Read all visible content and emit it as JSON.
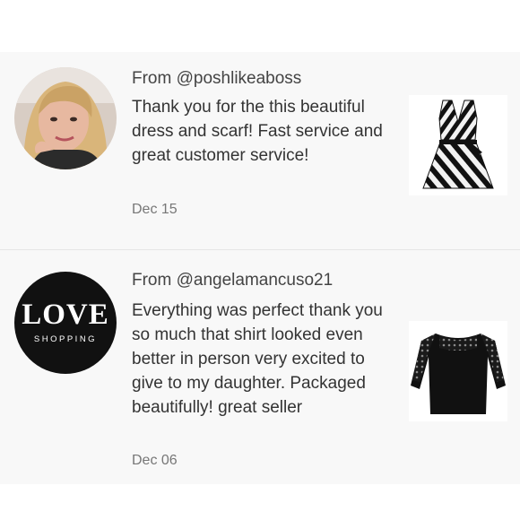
{
  "reviews": [
    {
      "from": "From @poshlikeaboss",
      "message": "Thank you for the this beautiful dress and scarf! Fast service and great customer service!",
      "date": "Dec 15",
      "avatar_icon": "user-photo",
      "item_icon": "striped-dress"
    },
    {
      "from": "From @angelamancuso21",
      "message": "Everything was perfect thank you so much that shirt looked even better in person very excited to give to my daughter. Packaged beautifully! great seller",
      "date": "Dec 06",
      "avatar_logo": {
        "word": "LOVE",
        "subtitle": "SHOPPING"
      },
      "item_icon": "black-lace-shirt"
    }
  ],
  "colors": {
    "feed_background": "#f8f8f8",
    "divider": "#e6e6e6",
    "text_primary": "#333333",
    "text_secondary": "#777777"
  }
}
